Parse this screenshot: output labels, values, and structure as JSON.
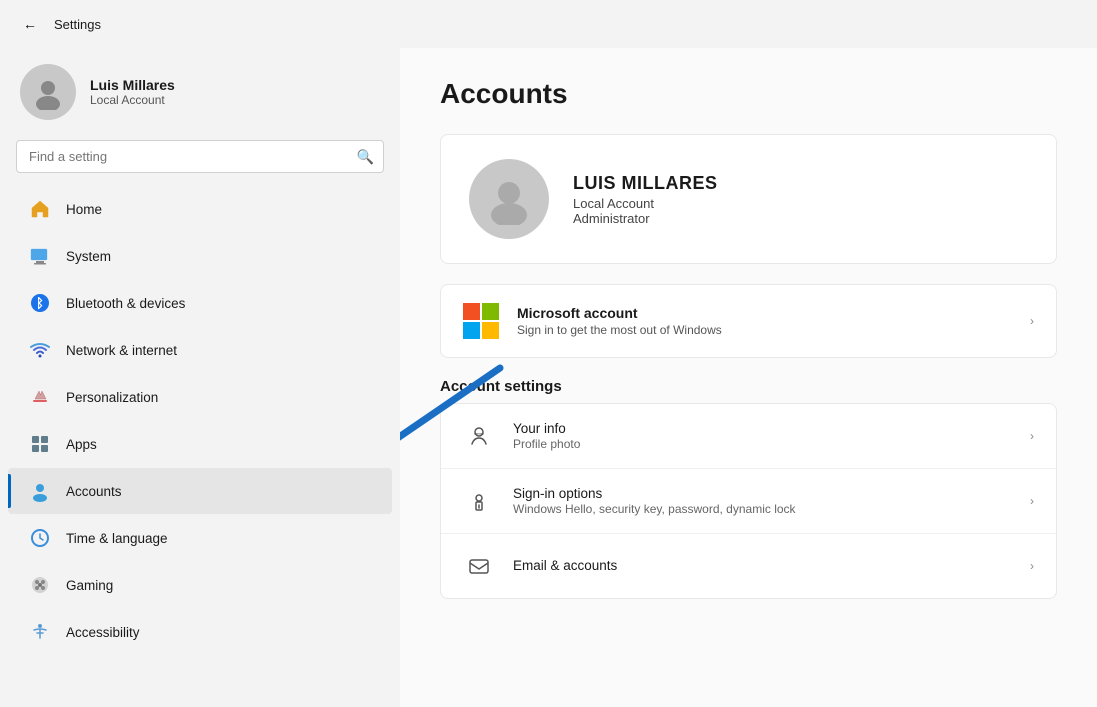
{
  "titleBar": {
    "backLabel": "←",
    "title": "Settings"
  },
  "sidebar": {
    "user": {
      "name": "Luis Millares",
      "type": "Local Account"
    },
    "search": {
      "placeholder": "Find a setting"
    },
    "navItems": [
      {
        "id": "home",
        "label": "Home",
        "icon": "🏠"
      },
      {
        "id": "system",
        "label": "System",
        "icon": "🖥"
      },
      {
        "id": "bluetooth",
        "label": "Bluetooth & devices",
        "icon": "🔵"
      },
      {
        "id": "network",
        "label": "Network & internet",
        "icon": "📶"
      },
      {
        "id": "personalization",
        "label": "Personalization",
        "icon": "✏️"
      },
      {
        "id": "apps",
        "label": "Apps",
        "icon": "📦"
      },
      {
        "id": "accounts",
        "label": "Accounts",
        "icon": "👤",
        "active": true
      },
      {
        "id": "time",
        "label": "Time & language",
        "icon": "🌐"
      },
      {
        "id": "gaming",
        "label": "Gaming",
        "icon": "🎮"
      },
      {
        "id": "accessibility",
        "label": "Accessibility",
        "icon": "♿"
      }
    ]
  },
  "content": {
    "pageTitle": "Accounts",
    "userCard": {
      "name": "LUIS MILLARES",
      "type": "Local Account",
      "role": "Administrator"
    },
    "msAccount": {
      "title": "Microsoft account",
      "subtitle": "Sign in to get the most out of Windows"
    },
    "accountSettings": {
      "sectionTitle": "Account settings",
      "items": [
        {
          "id": "your-info",
          "title": "Your info",
          "subtitle": "Profile photo",
          "icon": "👤"
        },
        {
          "id": "sign-in",
          "title": "Sign-in options",
          "subtitle": "Windows Hello, security key, password, dynamic lock",
          "icon": "🔑"
        },
        {
          "id": "email",
          "title": "Email & accounts",
          "subtitle": "",
          "icon": "✉️"
        }
      ]
    }
  }
}
